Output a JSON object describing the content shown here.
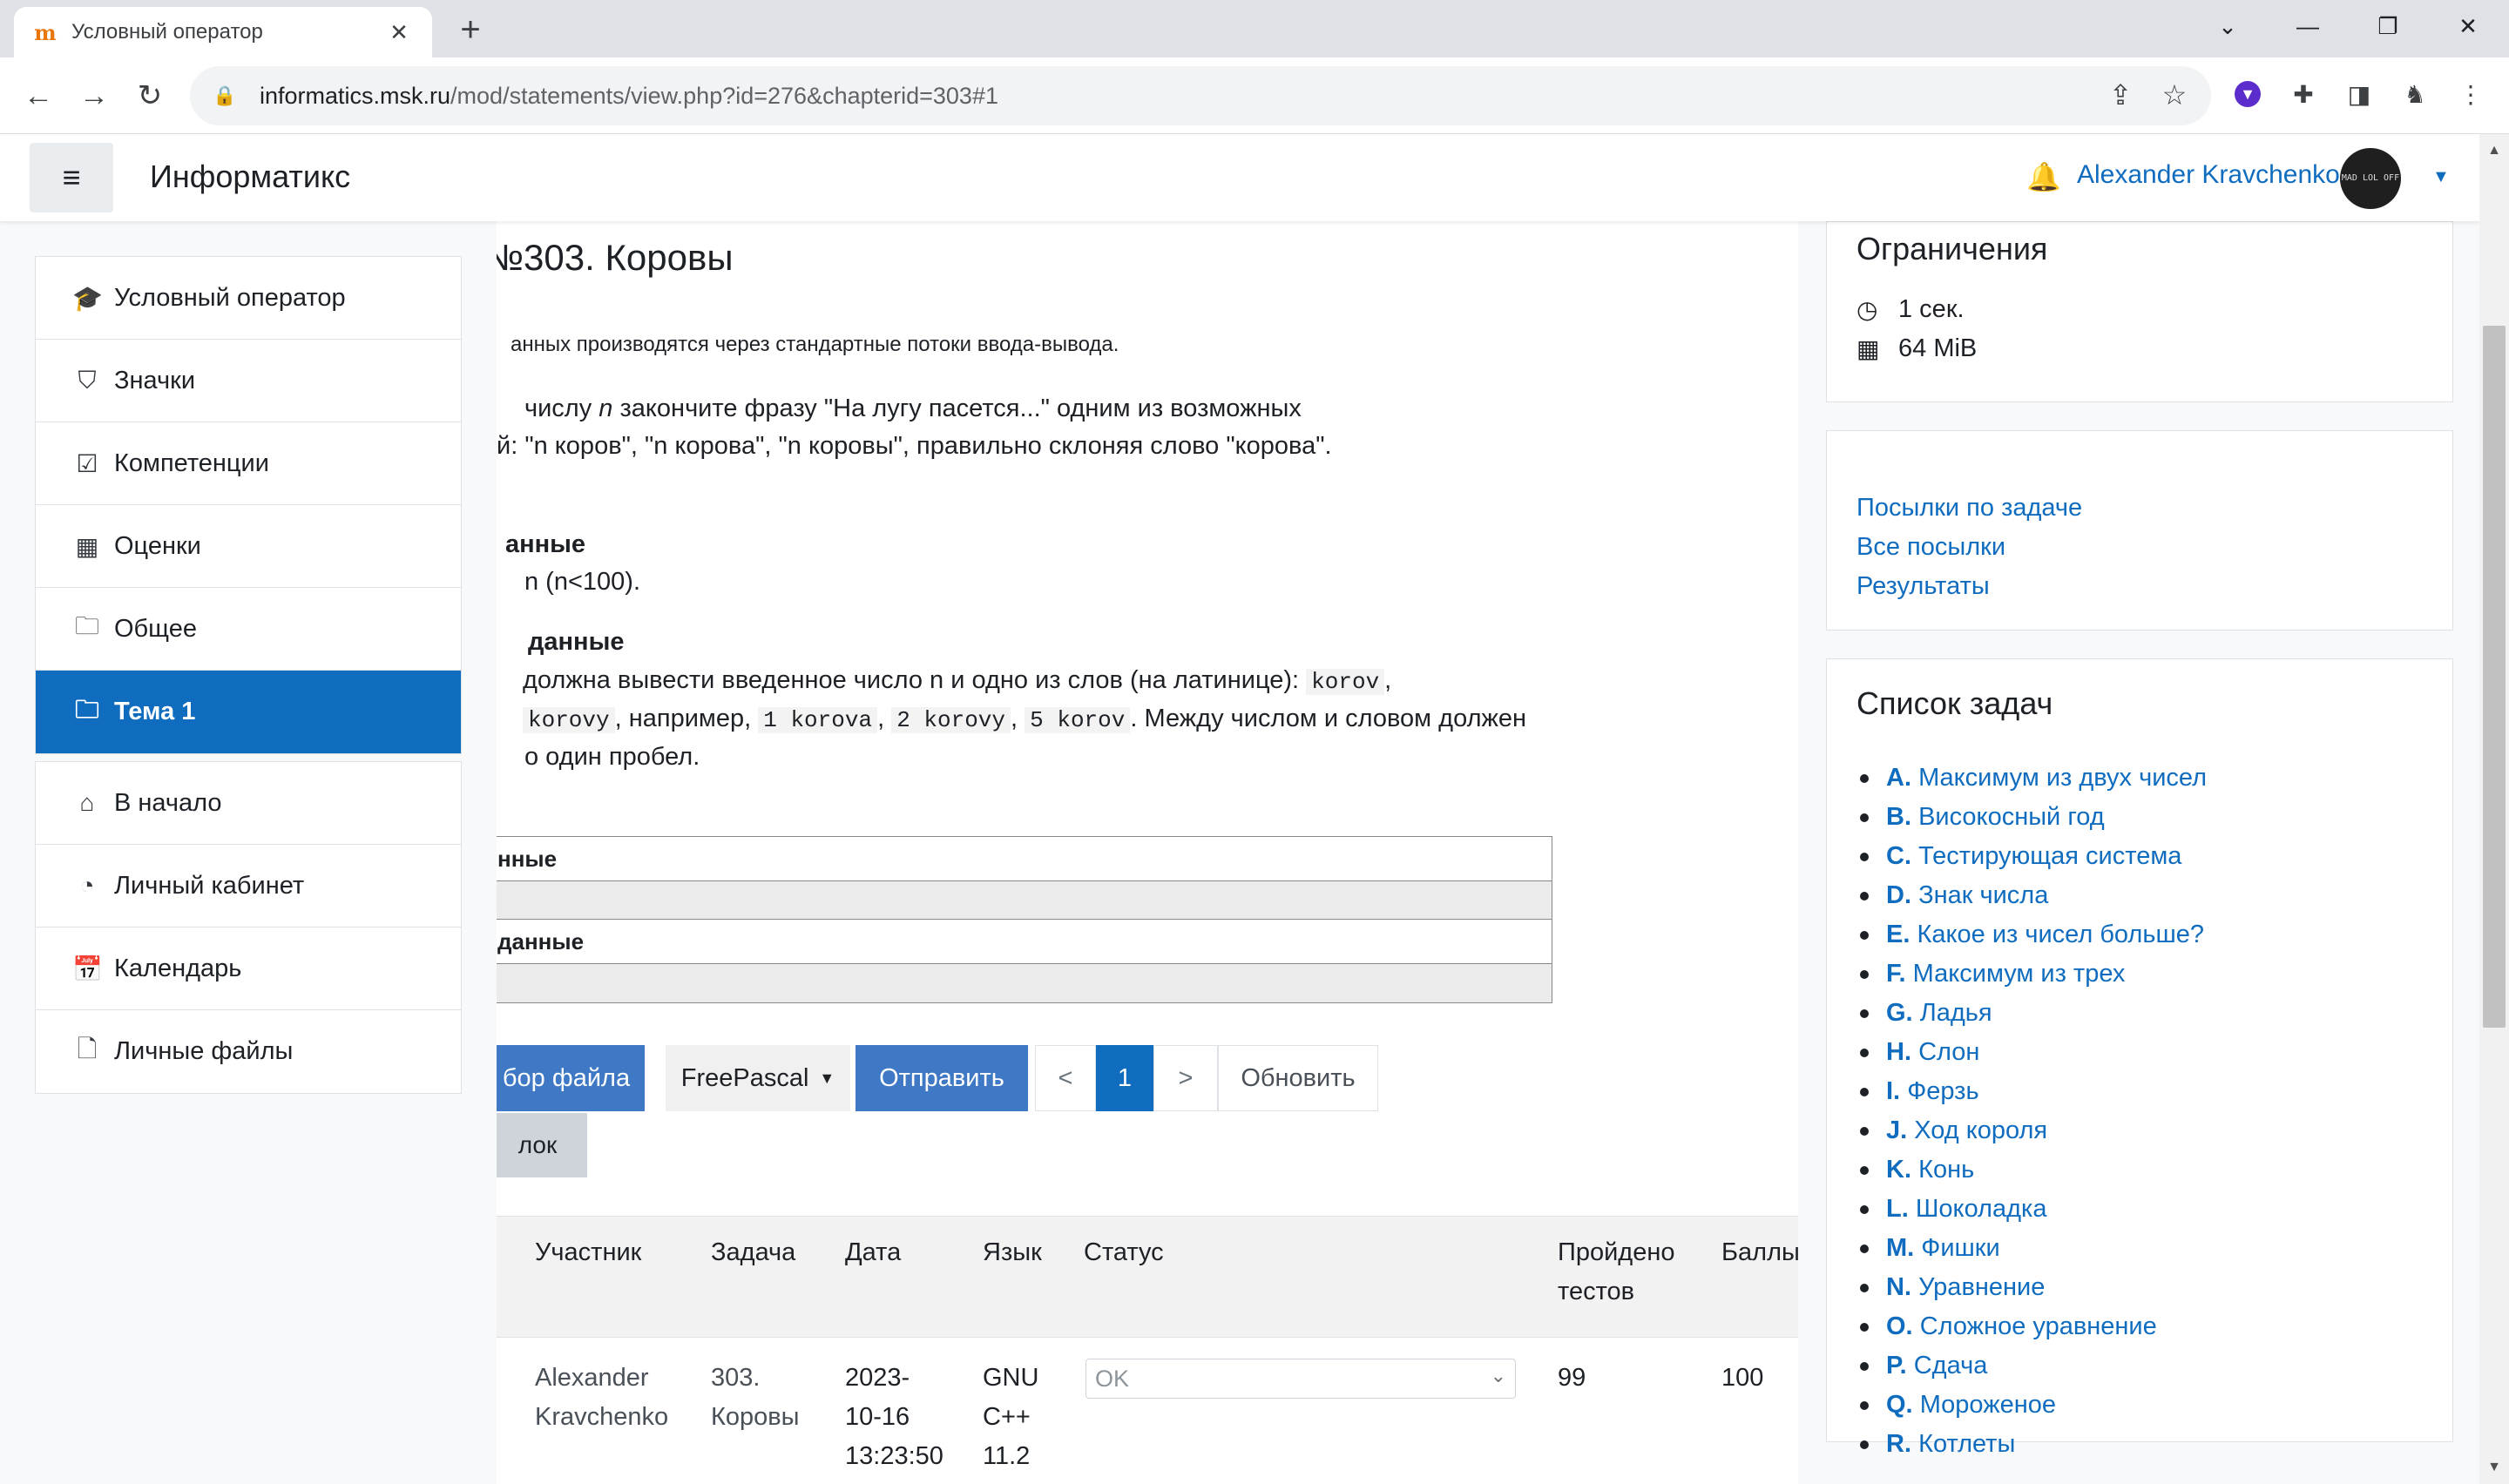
{
  "browser": {
    "tab_title": "Условный оператор",
    "tab_favicon": "m",
    "url_host": "informatics.msk.ru",
    "url_path": "/mod/statements/view.php?id=276&chapterid=303#1"
  },
  "navbar": {
    "brand": "Информатикс",
    "user_name": "Alexander Kravchenko",
    "avatar_text": "MAD LOL OFF"
  },
  "leftnav": {
    "group1": [
      {
        "icon": "graduation-cap-icon",
        "label": "Условный оператор"
      },
      {
        "icon": "shield-icon",
        "label": "Значки"
      },
      {
        "icon": "check-square-icon",
        "label": "Компетенции"
      },
      {
        "icon": "table-icon",
        "label": "Оценки"
      },
      {
        "icon": "folder-icon",
        "label": "Общее"
      },
      {
        "icon": "folder-icon",
        "label": "Тема 1",
        "active": true
      }
    ],
    "group2": [
      {
        "icon": "home-icon",
        "label": "В начало"
      },
      {
        "icon": "dashboard-icon",
        "label": "Личный кабинет"
      },
      {
        "icon": "calendar-icon",
        "label": "Календарь"
      },
      {
        "icon": "file-icon",
        "label": "Личные файлы"
      }
    ]
  },
  "main": {
    "title": "№303. Коровы",
    "io_note": "анных производятся через стандартные потоки ввода-вывода.",
    "statement_line1_a": "числу ",
    "statement_line1_n": "n",
    "statement_line1_b": " закончите фразу \"На лугу пасется...\" одним из возможных",
    "statement_line2": "й: \"n коров\", \"n корова\", \"n коровы\", правильно склоняя слово \"корова\".",
    "input_heading": "анные",
    "input_text": "n (n<100).",
    "output_heading": "данные",
    "output_line1": "должна вывести введенное число n и одно из слов (на латинице): ",
    "output_code1": "korov",
    "output_code2": "korovy",
    "output_line2_a": ", например, ",
    "output_code3": "1 korova",
    "output_code4": "2 korovy",
    "output_code5": "5 korov",
    "output_line2_b": ". Между числом и словом должен",
    "output_line3": "о один пробел.",
    "example_table": {
      "input_label": "нные",
      "output_label": "данные"
    },
    "buttons": {
      "choose_file": "бор файла",
      "language": "FreePascal",
      "submit": "Отправить",
      "prev": "<",
      "page": "1",
      "next": ">",
      "refresh": "Обновить",
      "gray": "лок"
    },
    "submissions": {
      "headers": {
        "participant": "Участник",
        "task": "Задача",
        "date": "Дата",
        "lang": "Язык",
        "status": "Статус",
        "tests_1": "Пройдено",
        "tests_2": "тестов",
        "score": "Баллы"
      },
      "row": {
        "participant_1": "Alexander",
        "participant_2": "Kravchenko",
        "task_1": "303.",
        "task_2": "Коровы",
        "date_1": "2023-",
        "date_2": "10-16",
        "date_3": "13:23:50",
        "lang_1": "GNU",
        "lang_2": "C++",
        "lang_3": "11.2",
        "status": "OK",
        "tests": "99",
        "score": "100"
      }
    }
  },
  "right": {
    "limits_title": "Ограничения",
    "time_limit": "1 сек.",
    "memory_limit": "64 MiB",
    "links": [
      "Посылки по задаче",
      "Все посылки",
      "Результаты"
    ],
    "tasks_title": "Список задач",
    "tasks": [
      {
        "letter": "A.",
        "name": "Максимум из двух чисел"
      },
      {
        "letter": "B.",
        "name": "Високосный год"
      },
      {
        "letter": "C.",
        "name": "Тестирующая система"
      },
      {
        "letter": "D.",
        "name": "Знак числа"
      },
      {
        "letter": "E.",
        "name": "Какое из чисел больше?"
      },
      {
        "letter": "F.",
        "name": "Максимум из трех"
      },
      {
        "letter": "G.",
        "name": "Ладья"
      },
      {
        "letter": "H.",
        "name": "Слон"
      },
      {
        "letter": "I.",
        "name": "Ферзь"
      },
      {
        "letter": "J.",
        "name": "Ход короля"
      },
      {
        "letter": "K.",
        "name": "Конь"
      },
      {
        "letter": "L.",
        "name": "Шоколадка"
      },
      {
        "letter": "M.",
        "name": "Фишки"
      },
      {
        "letter": "N.",
        "name": "Уравнение"
      },
      {
        "letter": "O.",
        "name": "Сложное уравнение"
      },
      {
        "letter": "P.",
        "name": "Сдача"
      },
      {
        "letter": "Q.",
        "name": "Мороженое"
      },
      {
        "letter": "R.",
        "name": "Котлеты"
      }
    ]
  },
  "colors": {
    "brand_blue": "#0f6cbf",
    "button_blue": "#3f78c4",
    "favicon_orange": "#e8760c"
  }
}
